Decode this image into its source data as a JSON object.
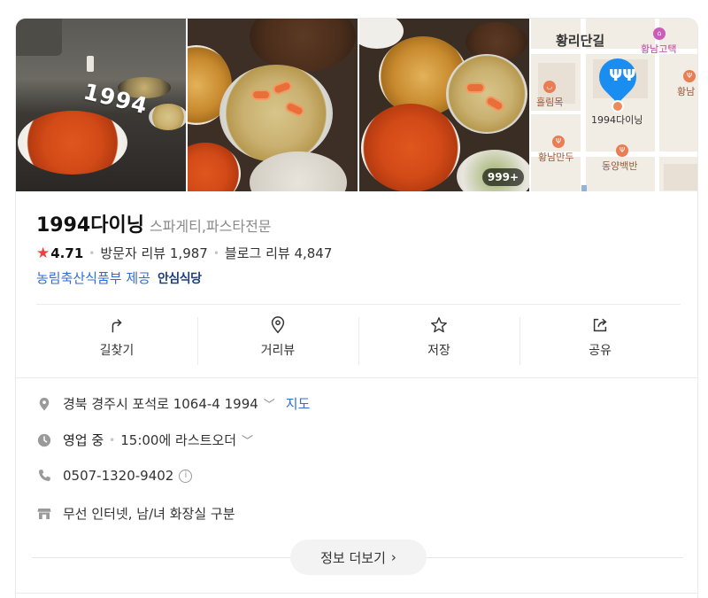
{
  "photos": {
    "watermark": "1994",
    "more_count": "999+"
  },
  "map": {
    "street_label": "황리단길",
    "poi_top_right": "황남고택",
    "poi_right_edge": "황남",
    "poi_left": "흘림목",
    "pin_label": "1994다이닝",
    "poi_bottom_left": "황남만두",
    "poi_bottom_right": "동양백반"
  },
  "place": {
    "name": "1994다이닝",
    "category": "스파게티,파스타전문",
    "rating": "4.71",
    "visitor_reviews": "방문자 리뷰 1,987",
    "blog_reviews": "블로그 리뷰 4,847",
    "certification": "농림축산식품부 제공",
    "cert_badge": "안심식당"
  },
  "actions": [
    {
      "label": "길찾기",
      "icon": "directions-icon"
    },
    {
      "label": "거리뷰",
      "icon": "street-view-icon"
    },
    {
      "label": "저장",
      "icon": "star-outline-icon"
    },
    {
      "label": "공유",
      "icon": "share-icon"
    }
  ],
  "info": {
    "address": "경북 경주시 포석로 1064-4 1994",
    "map_link": "지도",
    "hours_status": "영업 중",
    "hours_detail": "15:00에 라스트오더",
    "phone": "0507-1320-9402",
    "amenities": "무선 인터넷, 남/녀 화장실 구분"
  },
  "more_button": "정보 더보기",
  "colors": {
    "accent_blue": "#2f6dd5",
    "star_red": "#f0423d",
    "pin_blue": "#1a8ef0"
  }
}
